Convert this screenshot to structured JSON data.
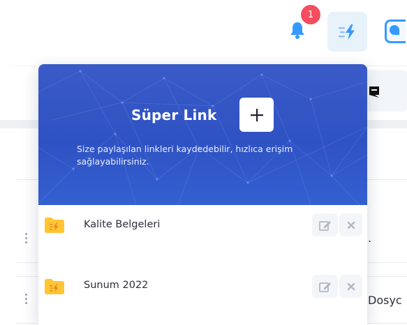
{
  "header": {
    "notification_count": "1",
    "notification_icon": "bell-icon",
    "superlink_icon": "bolt-lines-icon"
  },
  "super_link": {
    "title": "Süper Link",
    "add_icon": "plus-icon",
    "description": "Size paylaşılan linkleri kaydedebilir, hızlıca erişim sağlayabilirsiniz.",
    "items": [
      {
        "label": "Kalite Belgeleri",
        "icon": "folder-bolt-icon",
        "edit_icon": "edit-icon",
        "delete_icon": "close-icon"
      },
      {
        "label": "Sunum 2022",
        "icon": "folder-bolt-icon",
        "edit_icon": "edit-icon",
        "delete_icon": "close-icon"
      }
    ]
  },
  "background": {
    "partial_text": "Dosyc"
  },
  "colors": {
    "accent": "#3699FF",
    "hero_blue": "#2F52C3",
    "badge": "#F64E60",
    "folder": "#FFC533"
  }
}
